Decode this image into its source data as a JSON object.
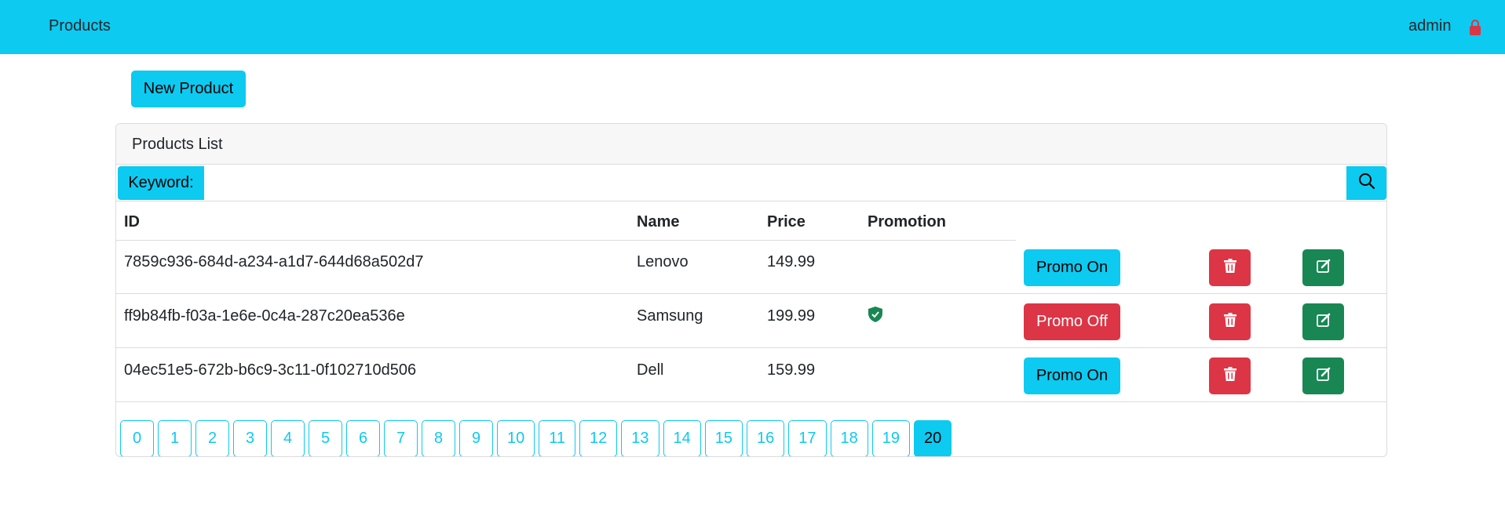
{
  "navbar": {
    "brand": "Products",
    "user": "admin",
    "lock_icon": "lock-icon",
    "lock_color": "#dc3545"
  },
  "actions": {
    "new_product_label": "New Product"
  },
  "card": {
    "title": "Products List"
  },
  "search": {
    "label": "Keyword:",
    "value": "",
    "icon": "search-icon"
  },
  "table": {
    "headers": [
      "ID",
      "Name",
      "Price",
      "Promotion"
    ],
    "rows": [
      {
        "id": "7859c936-684d-a234-a1d7-644d68a502d7",
        "name": "Lenovo",
        "price": "149.99",
        "promotion": false,
        "promo_label": "Promo On"
      },
      {
        "id": "ff9b84fb-f03a-1e6e-0c4a-287c20ea536e",
        "name": "Samsung",
        "price": "199.99",
        "promotion": true,
        "promo_label": "Promo Off"
      },
      {
        "id": "04ec51e5-672b-b6c9-3c11-0f102710d506",
        "name": "Dell",
        "price": "159.99",
        "promotion": false,
        "promo_label": "Promo On"
      }
    ]
  },
  "pagination": {
    "pages": [
      "0",
      "1",
      "2",
      "3",
      "4",
      "5",
      "6",
      "7",
      "8",
      "9",
      "10",
      "11",
      "12",
      "13",
      "14",
      "15",
      "16",
      "17",
      "18",
      "19",
      "20"
    ],
    "current": "20"
  },
  "colors": {
    "info": "#0dcaf0",
    "danger": "#dc3545",
    "success": "#198754"
  }
}
